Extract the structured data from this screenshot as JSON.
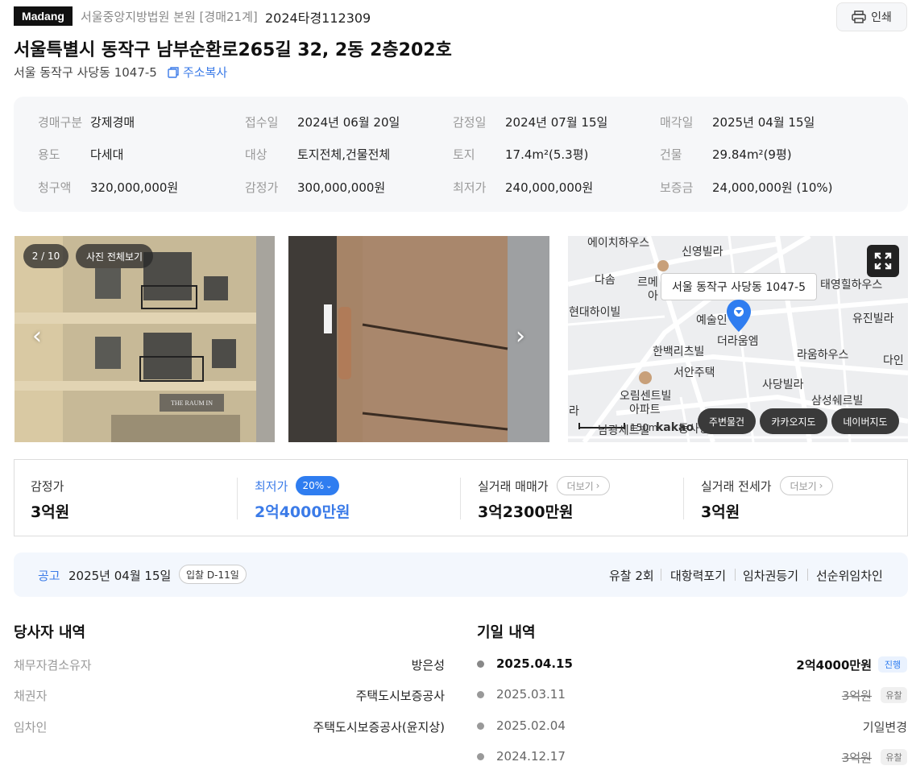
{
  "header": {
    "logo": "Madang",
    "court": "서울중앙지방법원 본원 [경매21계]",
    "case_no": "2024타경112309",
    "print_label": "인쇄",
    "title": "서울특별시 동작구 남부순환로265길 32, 2동 2층202호",
    "address": "서울 동작구 사당동 1047-5",
    "copy_label": "주소복사"
  },
  "info": {
    "rows": [
      [
        {
          "label": "경매구분",
          "value": "강제경매"
        },
        {
          "label": "접수일",
          "value": "2024년 06월 20일"
        },
        {
          "label": "감정일",
          "value": "2024년 07월 15일"
        },
        {
          "label": "매각일",
          "value": "2025년 04월 15일"
        }
      ],
      [
        {
          "label": "용도",
          "value": "다세대"
        },
        {
          "label": "대상",
          "value": "토지전체,건물전체"
        },
        {
          "label": "토지",
          "value": "17.4m²(5.3평)"
        },
        {
          "label": "건물",
          "value": "29.84m²(9평)"
        }
      ],
      [
        {
          "label": "청구액",
          "value": "320,000,000원"
        },
        {
          "label": "감정가",
          "value": "300,000,000원"
        },
        {
          "label": "최저가",
          "value": "240,000,000원"
        },
        {
          "label": "보증금",
          "value": "24,000,000원 (10%)"
        }
      ]
    ]
  },
  "gallery": {
    "counter": "2 / 10",
    "view_all": "사진 전체보기",
    "building_sign": "THE RAUM IN"
  },
  "map": {
    "tooltip": "서울 동작구 사당동 1047-5",
    "labels": [
      "에이치하우스",
      "신영빌라",
      "다솜",
      "르메",
      "아",
      "태영힐하우스",
      "현대하이빌",
      "예술인",
      "유진빌라",
      "더라움엠",
      "한백리츠빌",
      "라움하우스",
      "다인",
      "서안주택",
      "오림센트빌",
      "아파트",
      "사당빌라",
      "삼성쉐르빌",
      "라",
      "건영",
      "남광세트빌",
      "동사랑"
    ],
    "scale": "150m",
    "brand": "kakao",
    "buttons": [
      "주변물건",
      "카카오지도",
      "네이버지도"
    ]
  },
  "prices": [
    {
      "label": "감정가",
      "value": "3억원"
    },
    {
      "label": "최저가",
      "value": "2억4000만원",
      "badge": "20%"
    },
    {
      "label": "실거래 매매가",
      "value": "3억2300만원",
      "more": "더보기"
    },
    {
      "label": "실거래 전세가",
      "value": "3억원",
      "more": "더보기"
    }
  ],
  "notice": {
    "label": "공고",
    "date": "2025년 04월 15일",
    "dday": "입찰 D-11일",
    "flags": [
      "유찰 2회",
      "대항력포기",
      "임차권등기",
      "선순위임차인"
    ]
  },
  "parties": {
    "title": "당사자 내역",
    "rows": [
      {
        "label": "채무자겸소유자",
        "value": "방은성"
      },
      {
        "label": "채권자",
        "value": "주택도시보증공사"
      },
      {
        "label": "임차인",
        "value": "주택도시보증공사(윤지상)"
      }
    ]
  },
  "schedule": {
    "title": "기일 내역",
    "rows": [
      {
        "date": "2025.04.15",
        "price": "2억4000만원",
        "status": "진행"
      },
      {
        "date": "2025.03.11",
        "price": "3억원",
        "status": "유찰"
      },
      {
        "date": "2025.02.04",
        "price": "기일변경",
        "status": ""
      },
      {
        "date": "2024.12.17",
        "price": "3억원",
        "status": "유찰"
      }
    ]
  },
  "colors": {
    "accent": "#3b7be8",
    "dark": "#111111",
    "panel": "#f6f7f9",
    "notice_bg": "#f3f7fd"
  }
}
